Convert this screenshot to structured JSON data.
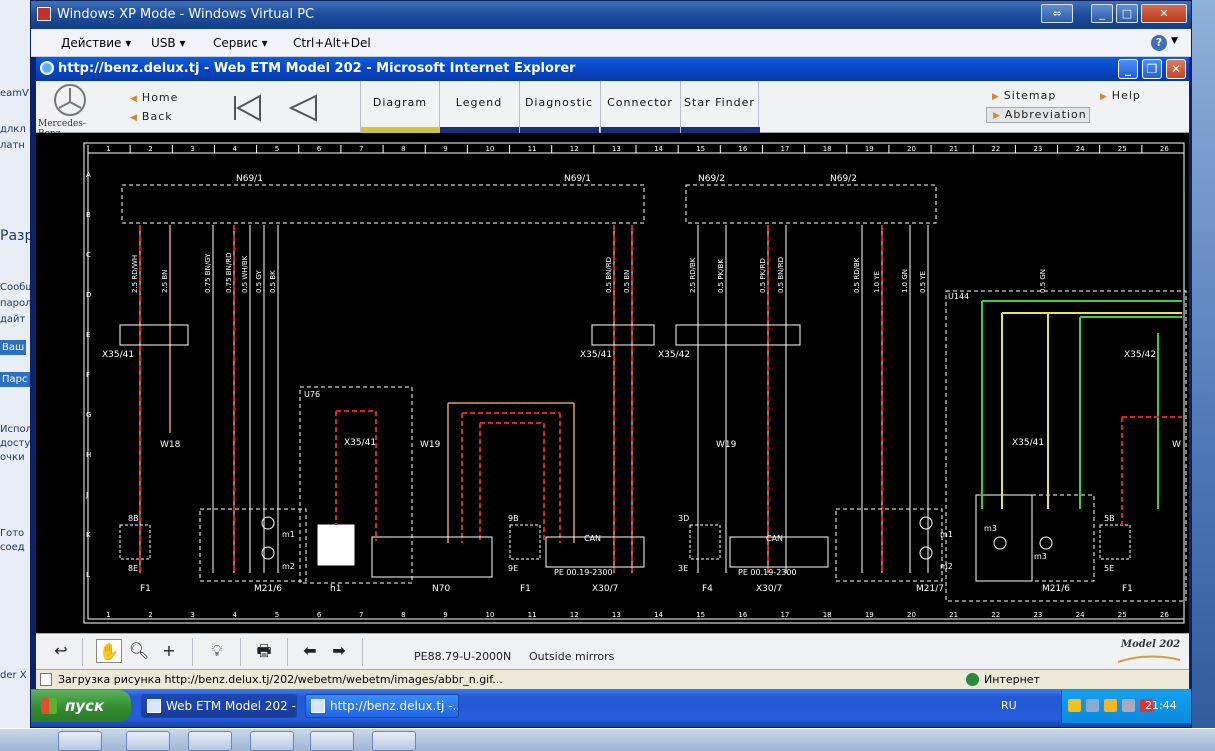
{
  "host": {
    "left_fragments": [
      "eamV",
      "длкл",
      "латн",
      "Разр",
      "Сообщ",
      "пароль",
      "дайт",
      "Ваш",
      "Парс",
      "Испол",
      "досту",
      "очки",
      "Гото",
      "соед",
      "der X"
    ]
  },
  "vm_window": {
    "title": "Windows XP Mode - Windows Virtual PC",
    "menu": [
      "Действие",
      "USB",
      "Сервис",
      "Ctrl+Alt+Del"
    ],
    "help_glyph": "?"
  },
  "ie": {
    "title": "http://benz.delux.tj - Web ETM Model 202 - Microsoft Internet Explorer",
    "status_text": "Загрузка рисунка http://benz.delux.tj/202/webetm/webetm/images/abbr_n.gif...",
    "zone": "Интернет"
  },
  "etm": {
    "brand": "Mercedes-Benz",
    "home": "Home",
    "back": "Back",
    "tabs": [
      "Diagram",
      "Legend",
      "Diagnostic",
      "Connector",
      "Star Finder"
    ],
    "active_tab": "Diagram",
    "sitemap": "Sitemap",
    "help": "Help",
    "abbreviation": "Abbreviation",
    "doc_code": "PE88.79-U-2000N",
    "doc_title": "Outside mirrors",
    "model_label": "Model 202"
  },
  "diagram": {
    "columns": [
      "1",
      "2",
      "3",
      "4",
      "5",
      "6",
      "7",
      "8",
      "9",
      "10",
      "11",
      "12",
      "13",
      "14",
      "15",
      "16",
      "17",
      "18",
      "19",
      "20",
      "21",
      "22",
      "23",
      "24",
      "25",
      "26"
    ],
    "rows": [
      "A",
      "B",
      "C",
      "D",
      "E",
      "F",
      "G",
      "H",
      "J",
      "K",
      "L"
    ],
    "top_labels": [
      "N69/1",
      "N69/1",
      "N69/2",
      "N69/2"
    ],
    "connectors": [
      "X35/41",
      "X35/41",
      "X35/42",
      "X35/41",
      "X35/41",
      "X35/42"
    ],
    "wire_labels": [
      "2.5 RD/WH",
      "2.5 BN",
      "0.75 BN/GY",
      "0.75 BN/RD",
      "0.5 WH/BK",
      "0.5 GY",
      "0.5 BK",
      "0.5 BN/RD",
      "0.5 BN",
      "2.5 RD/BK",
      "0.5 PK/BK",
      "0.5 PK/RD",
      "0.5 BN/RD",
      "0.5 RD/BK",
      "1.0 YE",
      "1.0 GN",
      "0.5 YE",
      "0.5 GN"
    ],
    "grounds": [
      "W18",
      "W19",
      "W19",
      "W"
    ],
    "components": [
      "F1",
      "M21/6",
      "h1",
      "N70",
      "F1",
      "X30/7",
      "F4",
      "X30/7",
      "M21/7",
      "M21/6",
      "F1",
      "U76",
      "U144",
      "m1",
      "m2",
      "m3",
      "m1",
      "m2",
      "m3"
    ],
    "fuses": [
      "8B",
      "8E",
      "9B",
      "9E",
      "3D",
      "3E",
      "5B",
      "5E"
    ],
    "can_labels": [
      "CAN",
      "CAN"
    ],
    "pe_labels": [
      "PE 00.19-2300",
      "PE 00.19-2300"
    ]
  },
  "xp_taskbar": {
    "start": "пуск",
    "tasks": [
      "Web ETM Model 202 -...",
      "http://benz.delux.tj -..."
    ],
    "lang": "RU",
    "clock": "21:44"
  },
  "colors": {
    "xp_blue": "#245ddb",
    "wire_red": "#e02020",
    "wire_orange": "#d9a060",
    "wire_green": "#3ccf3c",
    "wire_yellow": "#e8e060",
    "diagram_bg": "#000000"
  }
}
